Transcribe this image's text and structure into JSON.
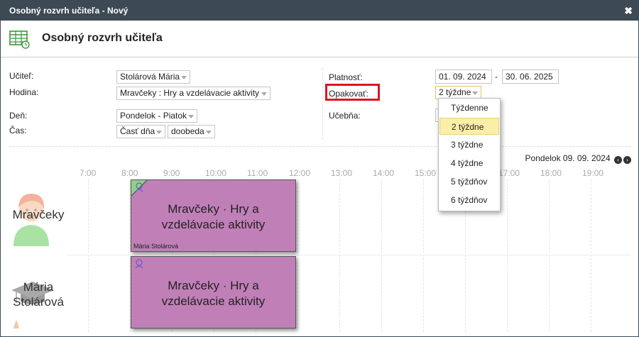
{
  "window": {
    "title": "Osobný rozvrh učiteľa - Nový",
    "close_glyph": "✖"
  },
  "header": {
    "title": "Osobný rozvrh učiteľa",
    "icon": "calendar-table-icon"
  },
  "form": {
    "teacher_label": "Učiteľ:",
    "teacher_value": "Stolárová Mária",
    "lesson_label": "Hodina:",
    "lesson_value": "Mravčeky : Hry a vzdelávacie aktivity",
    "day_label": "Deň:",
    "day_value": "Pondelok - Piatok",
    "time_label": "Čas:",
    "time_value_1": "Časť dňa",
    "time_value_2": "doobeda",
    "validity_label": "Platnosť:",
    "validity_from": "01. 09. 2024",
    "validity_sep": "-",
    "validity_to": "30. 06. 2025",
    "repeat_label": "Opakovať:",
    "repeat_value": "2 týždne",
    "room_label": "Učebňa:"
  },
  "repeat_options": [
    "Týždenne",
    "2 týždne",
    "3 týždne",
    "4 týždne",
    "5 týždňov",
    "6 týždňov"
  ],
  "repeat_selected_index": 1,
  "calendar": {
    "date_label": "Pondelok 09. 09. 2024",
    "prev_glyph": "‹",
    "next_glyph": "›",
    "hours": [
      "7:00",
      "8:00",
      "9:00",
      "10:00",
      "11:00",
      "12:00",
      "13:00",
      "14:00",
      "15:00",
      "16:00",
      "17:00",
      "18:00",
      "19:00"
    ],
    "rows": [
      {
        "label": "Mravčeky",
        "avatar": "child-avatar-icon"
      },
      {
        "label": "Mária Stolárová",
        "avatar": "teacher-avatar-icon"
      }
    ],
    "events": [
      {
        "title": "Mravčeky · Hry a vzdelávacie aktivity",
        "teacher": "Mária Stolárová",
        "icon": "group-icon"
      },
      {
        "title": "Mravčeky · Hry a vzdelávacie aktivity",
        "teacher": "",
        "icon": "group-icon"
      }
    ]
  },
  "colors": {
    "titlebar": "#3d4a55",
    "event": "#c17fb8",
    "highlight": "#e0141e",
    "selected_option": "#fbeea6"
  }
}
